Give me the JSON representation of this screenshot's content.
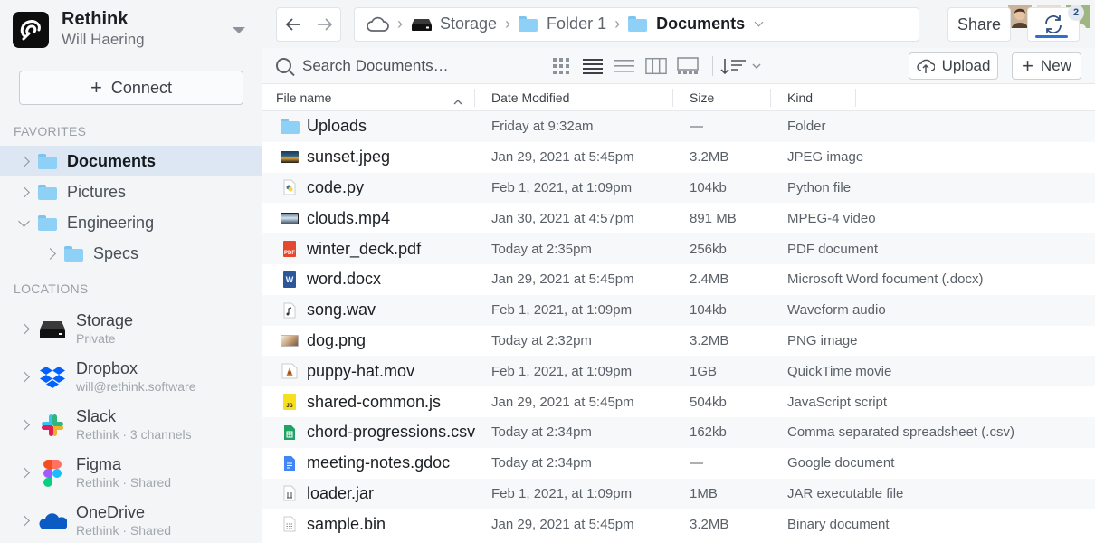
{
  "app": {
    "name": "Rethink",
    "user": "Will Haering"
  },
  "sidebar": {
    "connect_label": "Connect",
    "favorites_label": "FAVORITES",
    "locations_label": "LOCATIONS",
    "favorites": [
      {
        "label": "Documents",
        "active": true
      },
      {
        "label": "Pictures"
      },
      {
        "label": "Engineering",
        "expanded": true
      },
      {
        "label": "Specs",
        "child": true
      }
    ],
    "locations": [
      {
        "name": "Storage",
        "sub": "Private",
        "icon": "drive-icon"
      },
      {
        "name": "Dropbox",
        "sub": "will@rethink.software",
        "icon": "dropbox-icon"
      },
      {
        "name": "Slack",
        "sub": "Rethink · 3 channels",
        "icon": "slack-icon"
      },
      {
        "name": "Figma",
        "sub": "Rethink · Shared",
        "icon": "figma-icon"
      },
      {
        "name": "OneDrive",
        "sub": "Rethink · Shared",
        "icon": "onedrive-icon"
      }
    ]
  },
  "toolbar": {
    "breadcrumb": [
      "Storage",
      "Folder 1",
      "Documents"
    ],
    "share_label": "Share",
    "sync_badge": "2",
    "avatars": [
      {
        "color": "#8a6a55"
      },
      {
        "color": "#b06b4f"
      },
      {
        "color": "#6f8a55"
      }
    ]
  },
  "actions": {
    "search_placeholder": "Search Documents…",
    "upload_label": "Upload",
    "new_label": "New"
  },
  "table": {
    "columns": [
      "File name",
      "Date Modified",
      "Size",
      "Kind"
    ],
    "rows": [
      {
        "name": "Uploads",
        "date": "Friday at 9:32am",
        "size": "—",
        "kind": "Folder",
        "icon": "folder-icon"
      },
      {
        "name": "sunset.jpeg",
        "date": "Jan 29, 2021 at 5:45pm",
        "size": "3.2MB",
        "kind": "JPEG image",
        "icon": "image-icon"
      },
      {
        "name": "code.py",
        "date": "Feb 1, 2021, at 1:09pm",
        "size": "104kb",
        "kind": "Python file",
        "icon": "python-file-icon"
      },
      {
        "name": "clouds.mp4",
        "date": "Jan 30, 2021 at 4:57pm",
        "size": "891 MB",
        "kind": "MPEG-4 video",
        "icon": "video-icon"
      },
      {
        "name": "winter_deck.pdf",
        "date": "Today at 2:35pm",
        "size": "256kb",
        "kind": "PDF document",
        "icon": "pdf-icon"
      },
      {
        "name": "word.docx",
        "date": "Jan 29, 2021 at 5:45pm",
        "size": "2.4MB",
        "kind": "Microsoft Word focument (.docx)",
        "icon": "word-icon"
      },
      {
        "name": "song.wav",
        "date": "Feb 1, 2021, at 1:09pm",
        "size": "104kb",
        "kind": "Waveform audio",
        "icon": "audio-file-icon"
      },
      {
        "name": "dog.png",
        "date": "Today at 2:32pm",
        "size": "3.2MB",
        "kind": "PNG image",
        "icon": "image-icon"
      },
      {
        "name": "puppy-hat.mov",
        "date": "Feb 1, 2021, at 1:09pm",
        "size": "1GB",
        "kind": "QuickTime movie",
        "icon": "movie-icon"
      },
      {
        "name": "shared-common.js",
        "date": "Jan 29, 2021 at 5:45pm",
        "size": "504kb",
        "kind": "JavaScript script",
        "icon": "javascript-icon"
      },
      {
        "name": "chord-progressions.csv",
        "date": "Today at 2:34pm",
        "size": "162kb",
        "kind": "Comma separated spreadsheet (.csv)",
        "icon": "sheet-icon"
      },
      {
        "name": "meeting-notes.gdoc",
        "date": "Today at 2:34pm",
        "size": "—",
        "kind": "Google document",
        "icon": "gdoc-icon"
      },
      {
        "name": "loader.jar",
        "date": "Feb 1, 2021, at 1:09pm",
        "size": "1MB",
        "kind": "JAR executable file",
        "icon": "jar-file-icon"
      },
      {
        "name": "sample.bin",
        "date": "Jan 29, 2021 at 5:45pm",
        "size": "3.2MB",
        "kind": "Binary document",
        "icon": "binary-file-icon"
      }
    ]
  }
}
